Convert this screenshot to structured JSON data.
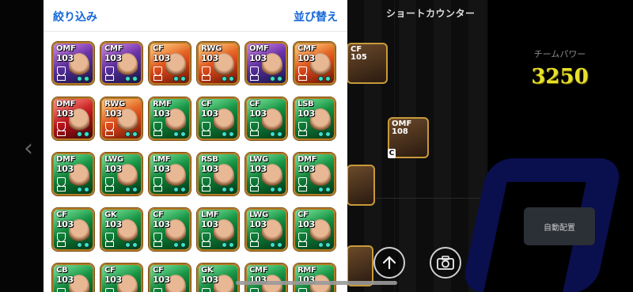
{
  "panel": {
    "filter_label": "絞り込み",
    "sort_label": "並び替え"
  },
  "game": {
    "formation_title": "ショートカウンター",
    "team_power_label": "チームパワー",
    "team_power_value": "3250",
    "auto_assign_label": "自動配置",
    "captain_badge": "C"
  },
  "pitch_cards": [
    {
      "pos": "CF",
      "rating": "105"
    },
    {
      "pos": "OMF",
      "rating": "108"
    }
  ],
  "cards": [
    {
      "pos": "OMF",
      "rating": "103",
      "style": "bg-purple"
    },
    {
      "pos": "CMF",
      "rating": "103",
      "style": "bg-purple"
    },
    {
      "pos": "CF",
      "rating": "103",
      "style": "bg-orange"
    },
    {
      "pos": "RWG",
      "rating": "103",
      "style": "bg-orange"
    },
    {
      "pos": "OMF",
      "rating": "103",
      "style": "bg-purple"
    },
    {
      "pos": "CMF",
      "rating": "103",
      "style": "bg-orange"
    },
    {
      "pos": "DMF",
      "rating": "103",
      "style": "bg-red"
    },
    {
      "pos": "RWG",
      "rating": "103",
      "style": "bg-orange"
    },
    {
      "pos": "RMF",
      "rating": "103",
      "style": "bg-green"
    },
    {
      "pos": "CF",
      "rating": "103",
      "style": "bg-green"
    },
    {
      "pos": "CF",
      "rating": "103",
      "style": "bg-green"
    },
    {
      "pos": "LSB",
      "rating": "103",
      "style": "bg-green"
    },
    {
      "pos": "DMF",
      "rating": "103",
      "style": "bg-green"
    },
    {
      "pos": "LWG",
      "rating": "103",
      "style": "bg-green"
    },
    {
      "pos": "LMF",
      "rating": "103",
      "style": "bg-green"
    },
    {
      "pos": "RSB",
      "rating": "103",
      "style": "bg-green"
    },
    {
      "pos": "LWG",
      "rating": "103",
      "style": "bg-green"
    },
    {
      "pos": "DMF",
      "rating": "103",
      "style": "bg-green"
    },
    {
      "pos": "CF",
      "rating": "103",
      "style": "bg-green"
    },
    {
      "pos": "GK",
      "rating": "103",
      "style": "bg-green"
    },
    {
      "pos": "CF",
      "rating": "103",
      "style": "bg-green"
    },
    {
      "pos": "LMF",
      "rating": "103",
      "style": "bg-green"
    },
    {
      "pos": "LWG",
      "rating": "103",
      "style": "bg-green"
    },
    {
      "pos": "CF",
      "rating": "103",
      "style": "bg-green"
    },
    {
      "pos": "CB",
      "rating": "103",
      "style": "bg-green"
    },
    {
      "pos": "CF",
      "rating": "103",
      "style": "bg-green"
    },
    {
      "pos": "CF",
      "rating": "103",
      "style": "bg-green"
    },
    {
      "pos": "GK",
      "rating": "103",
      "style": "bg-green"
    },
    {
      "pos": "CMF",
      "rating": "103",
      "style": "bg-green"
    },
    {
      "pos": "RMF",
      "rating": "103",
      "style": "bg-green"
    }
  ],
  "icons": {
    "upload": "upload-icon",
    "camera": "camera-icon",
    "back": "chevron-left-icon"
  }
}
